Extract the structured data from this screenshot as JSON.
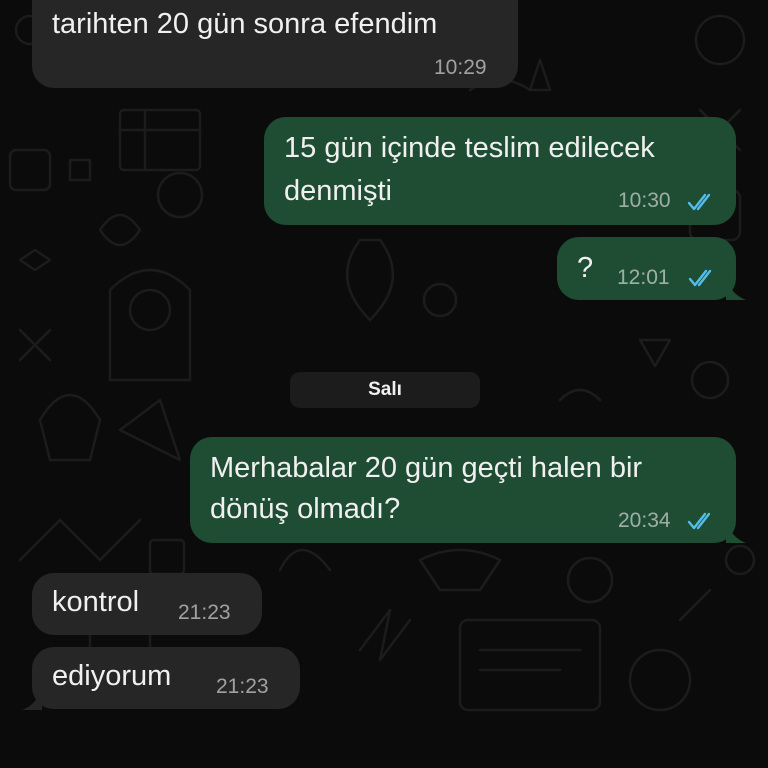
{
  "chat": {
    "day_separator": "Salı",
    "messages": [
      {
        "direction": "incoming",
        "lines": [
          "tarihten 20 gün sonra efendim"
        ],
        "time": "10:29"
      },
      {
        "direction": "outgoing",
        "lines": [
          "15 gün içinde teslim edilecek",
          "denmişti"
        ],
        "time": "10:30",
        "status": "read"
      },
      {
        "direction": "outgoing",
        "lines": [
          "?"
        ],
        "time": "12:01",
        "status": "read"
      },
      {
        "direction": "outgoing",
        "lines": [
          "Merhabalar 20 gün geçti halen bir",
          "dönüş olmadı?"
        ],
        "time": "20:34",
        "status": "read"
      },
      {
        "direction": "incoming",
        "lines": [
          "kontrol"
        ],
        "time": "21:23"
      },
      {
        "direction": "incoming",
        "lines": [
          "ediyorum"
        ],
        "time": "21:23"
      }
    ]
  },
  "colors": {
    "background": "#0b0b0b",
    "incoming_bubble": "#262626",
    "outgoing_bubble": "#1f4d34",
    "read_ticks": "#53bdeb"
  },
  "icons": {
    "read_status": "double-check-icon",
    "wallpaper": "doodle-pattern"
  }
}
